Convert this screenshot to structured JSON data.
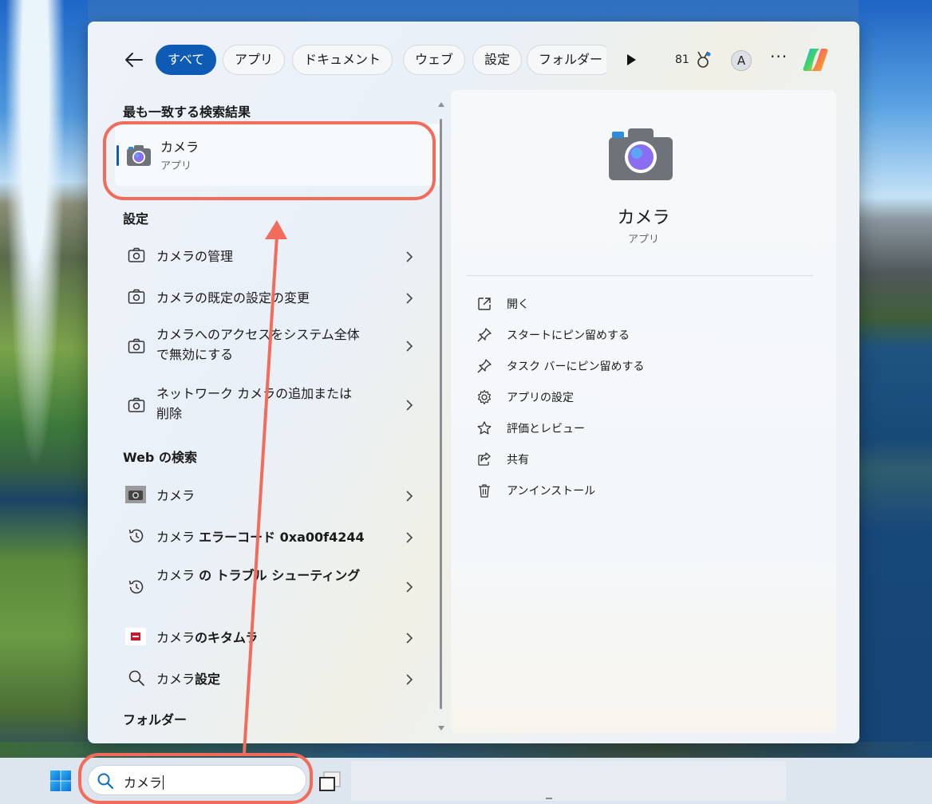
{
  "filters": {
    "tabs": [
      {
        "label": "すべて",
        "active": true
      },
      {
        "label": "アプリ"
      },
      {
        "label": "ドキュメント"
      },
      {
        "label": "ウェブ"
      },
      {
        "label": "設定"
      },
      {
        "label": "フォルダー"
      }
    ],
    "points": "81",
    "avatar": "A",
    "more": "···"
  },
  "best_match": {
    "heading": "最も一致する検索結果",
    "name": "カメラ",
    "type": "アプリ"
  },
  "settings": {
    "heading": "設定",
    "items": [
      {
        "label": "カメラの管理"
      },
      {
        "label": "カメラの既定の設定の変更"
      },
      {
        "label": "カメラへのアクセスをシステム全体で無効にする"
      },
      {
        "label": "ネットワーク カメラの追加または削除"
      }
    ]
  },
  "web": {
    "heading": "Web の検索",
    "items": [
      {
        "prefix": "カメラ",
        "bold": ""
      },
      {
        "prefix": "カメラ ",
        "bold": "エラーコード 0xa00f4244"
      },
      {
        "prefix": "カメラ ",
        "bold": "の トラブル シューティング"
      },
      {
        "prefix": "カメラ",
        "bold": "のキタムラ"
      },
      {
        "prefix": "カメラ",
        "bold": "設定"
      }
    ]
  },
  "folders": {
    "heading": "フォルダー"
  },
  "detail": {
    "title": "カメラ",
    "type": "アプリ",
    "actions": [
      {
        "label": "開く",
        "icon": "open-external-icon"
      },
      {
        "label": "スタートにピン留めする",
        "icon": "pin-icon"
      },
      {
        "label": "タスク バーにピン留めする",
        "icon": "pin-icon"
      },
      {
        "label": "アプリの設定",
        "icon": "gear-icon"
      },
      {
        "label": "評価とレビュー",
        "icon": "star-icon"
      },
      {
        "label": "共有",
        "icon": "share-icon"
      },
      {
        "label": "アンインストール",
        "icon": "trash-icon"
      }
    ]
  },
  "taskbar": {
    "search_value": "カメラ"
  },
  "colors": {
    "accent": "#0e5bb5",
    "annotation": "#f26b5b"
  }
}
